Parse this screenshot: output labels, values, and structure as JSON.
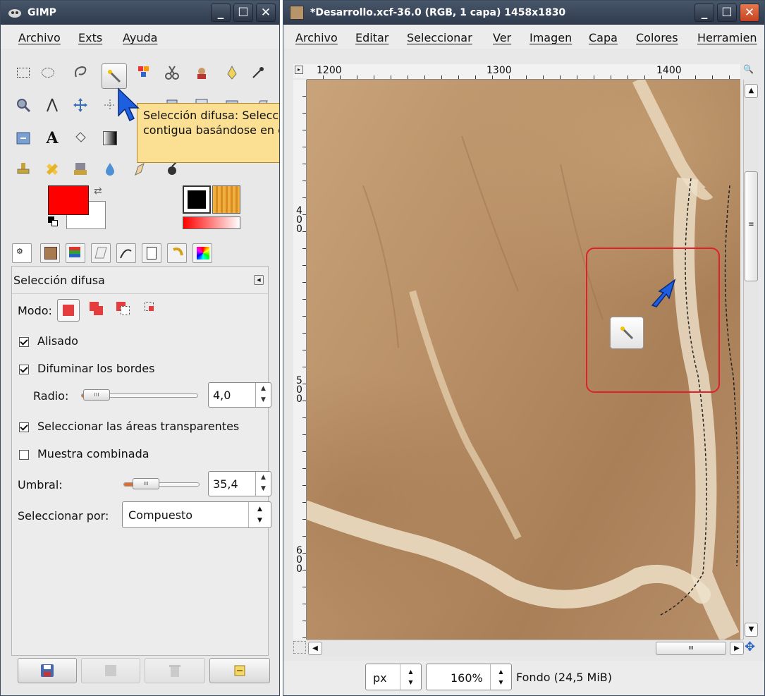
{
  "toolbox": {
    "title": "GIMP",
    "menu": [
      "Archivo",
      "Exts",
      "Ayuda"
    ],
    "tooltip": {
      "title": "Selección difusa",
      "text": ": Selecciona una región contigua basándose en el color (U)"
    }
  },
  "options": {
    "header": "Selección difusa",
    "mode_label": "Modo:",
    "antialias": {
      "label": "Alisado",
      "checked": true
    },
    "feather": {
      "label": "Difuminar los bordes",
      "checked": true
    },
    "radius": {
      "label": "Radio:",
      "value": "4,0",
      "fraction": 0.05
    },
    "transparent": {
      "label": "Seleccionar las áreas transparentes",
      "checked": true
    },
    "sample_merged": {
      "label": "Muestra combinada",
      "checked": false
    },
    "threshold": {
      "label": "Umbral:",
      "value": "35,4",
      "fraction": 0.14
    },
    "select_by": {
      "label": "Seleccionar por:",
      "value": "Compuesto"
    }
  },
  "image_window": {
    "title": "*Desarrollo.xcf-36.0 (RGB, 1 capa) 1458x1830",
    "menu": [
      "Archivo",
      "Editar",
      "Seleccionar",
      "Ver",
      "Imagen",
      "Capa",
      "Colores",
      "Herramien"
    ],
    "ruler_h": [
      "1200",
      "1300",
      "1400"
    ],
    "ruler_v": [
      "400",
      "500",
      "600"
    ],
    "unit": "px",
    "zoom": "160%",
    "status": "Fondo (24,5 MiB)"
  },
  "colors": {
    "fg": "#ff0000",
    "bg": "#ffffff",
    "highlight": "#e0202a",
    "tooltip": "#fbdf92"
  }
}
